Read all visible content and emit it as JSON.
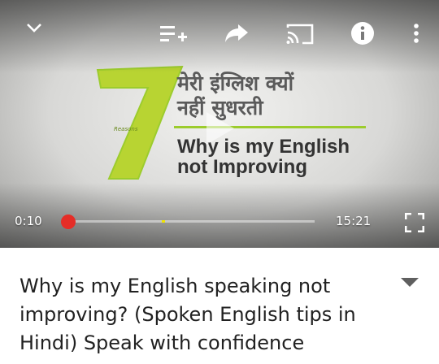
{
  "player": {
    "current_time": "0:10",
    "duration": "15:21",
    "progress_fraction": 0.011,
    "marker_fraction": 0.38,
    "frame": {
      "numeral": "7",
      "hindi_title": "मेरी इंग्लिश क्यों\nनहीं सुधरती",
      "reasons_label": "Reasons",
      "english_title": "Why is my English\nnot Improving"
    },
    "controls": {
      "collapse_icon": "chevron-down-icon",
      "add_to_playlist_icon": "playlist-add-icon",
      "share_icon": "share-icon",
      "cast_icon": "cast-icon",
      "info_icon": "info-icon",
      "more_icon": "more-vert-icon",
      "fullscreen_icon": "fullscreen-icon"
    },
    "colors": {
      "accent": "#e52d27",
      "marker": "#f2e600",
      "green": "#9ccc2d"
    }
  },
  "video": {
    "title": "Why is my English speaking not improving? (Spoken English tips in Hindi) Speak with confidence",
    "expand_icon": "expand-icon"
  }
}
